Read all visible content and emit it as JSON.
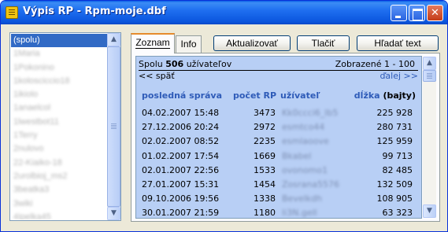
{
  "window": {
    "title": "Výpis RP - Rpm-moje.dbf"
  },
  "caption_buttons": {
    "minimize": "",
    "maximize": "",
    "close": "✕"
  },
  "userlist": {
    "items": [
      {
        "label": "(spolu)",
        "selected": true,
        "blurred": false
      },
      {
        "label": "1Maria",
        "selected": false,
        "blurred": true
      },
      {
        "label": "1Pokonino",
        "selected": false,
        "blurred": true
      },
      {
        "label": "1kolosciccio18",
        "selected": false,
        "blurred": true
      },
      {
        "label": "1ikiolo",
        "selected": false,
        "blurred": true
      },
      {
        "label": "1anaelcol",
        "selected": false,
        "blurred": true
      },
      {
        "label": "1lwestbot11",
        "selected": false,
        "blurred": true
      },
      {
        "label": "1Terry",
        "selected": false,
        "blurred": true
      },
      {
        "label": "2nulovo",
        "selected": false,
        "blurred": true
      },
      {
        "label": "22-Kiaiko-18",
        "selected": false,
        "blurred": true
      },
      {
        "label": "2urolbioj_ms2",
        "selected": false,
        "blurred": true
      },
      {
        "label": "3beatka3",
        "selected": false,
        "blurred": true
      },
      {
        "label": "3wiki",
        "selected": false,
        "blurred": true
      },
      {
        "label": "4Ipelka45",
        "selected": false,
        "blurred": true
      }
    ]
  },
  "tabs": [
    {
      "label": "Zoznam",
      "active": true
    },
    {
      "label": "Info",
      "active": false
    }
  ],
  "toolbar": {
    "refresh_label": "Aktualizovať",
    "print_label": "Tlačiť",
    "search_label": "Hľadať text"
  },
  "listing": {
    "summary_prefix": "Spolu ",
    "summary_count": "506",
    "summary_suffix": " užívateľov",
    "shown_range": "Zobrazené 1 - 100",
    "back_link": "<< späť",
    "next_link": "ďalej >>",
    "columns": {
      "last_message": "posledná správa",
      "count": "počet RP",
      "user": "užívateľ",
      "length": "dĺžka",
      "length_unit": "(bajty)"
    },
    "rows": [
      {
        "date": "04.02.2007 15:48",
        "count": "3473",
        "user": "Kk0ccci6_lb5",
        "length": "225 928"
      },
      {
        "date": "27.12.2006 20:24",
        "count": "2972",
        "user": "esmtco44",
        "length": "280 731"
      },
      {
        "date": "02.02.2007 08:52",
        "count": "2235",
        "user": "esmlaoove",
        "length": "125 959"
      },
      {
        "date": "01.02.2007 17:54",
        "count": "1669",
        "user": "Bkabel",
        "length": "99 713"
      },
      {
        "date": "02.01.2007 22:56",
        "count": "1533",
        "user": "ovonomo1",
        "length": "82 485"
      },
      {
        "date": "27.01.2007 15:31",
        "count": "1454",
        "user": "Zosrana5576",
        "length": "132 509"
      },
      {
        "date": "09.10.2006 19:56",
        "count": "1338",
        "user": "Bevelkdh",
        "length": "108 905"
      },
      {
        "date": "30.01.2007 21:59",
        "count": "1180",
        "user": "li3N.gell",
        "length": "63 323"
      }
    ]
  }
}
